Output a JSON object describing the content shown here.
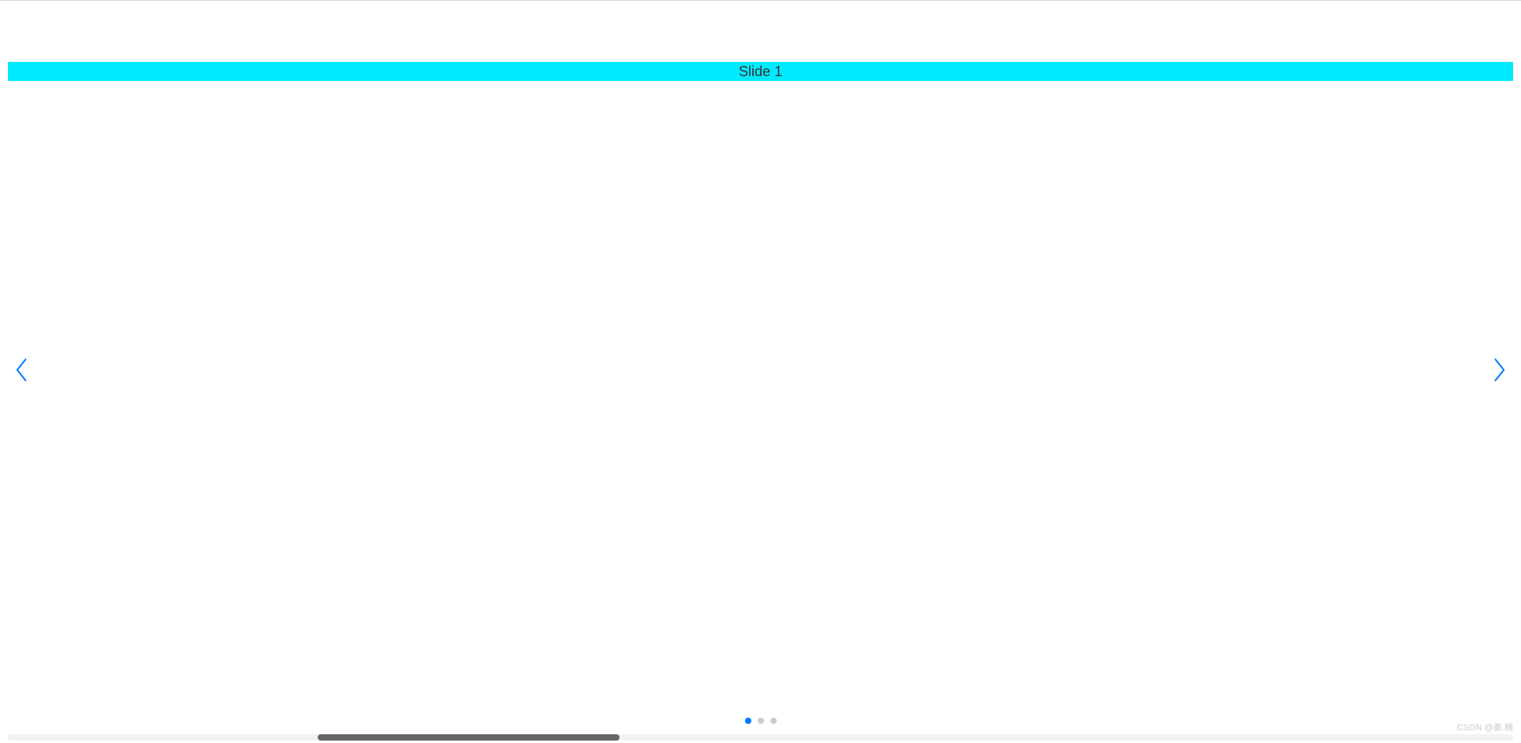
{
  "swiper": {
    "current_slide_label": "Slide 1",
    "bullets_count": 3,
    "active_bullet_index": 0
  },
  "watermark": "CSDN @秦.楠"
}
